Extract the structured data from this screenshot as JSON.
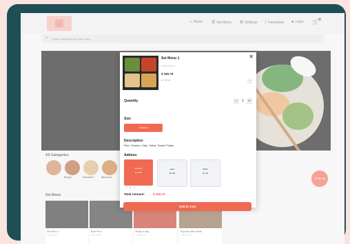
{
  "header": {
    "nav": [
      {
        "label": "Home",
        "icon": "home-icon"
      },
      {
        "label": "Set Menu",
        "icon": "menu-icon"
      },
      {
        "label": "Settings",
        "icon": "gear-icon"
      },
      {
        "label": "Favourites",
        "icon": "heart-icon"
      },
      {
        "label": "Login",
        "icon": "user-icon"
      }
    ]
  },
  "search": {
    "placeholder": "Search anything and find order..."
  },
  "categories": {
    "title": "All Categories",
    "items": [
      {
        "label": ""
      },
      {
        "label": "Burger"
      },
      {
        "label": "Sandwich"
      },
      {
        "label": "Barbecue"
      }
    ]
  },
  "fab": {
    "label": "Order All"
  },
  "set_menu": {
    "title": "Set Menu",
    "cards": [
      {
        "name": "Set Menu 1",
        "stars": "★★★★★"
      },
      {
        "name": "Bunt Set 2",
        "stars": "★★★★★"
      },
      {
        "name": "Single & Hay",
        "stars": "★★★★★"
      },
      {
        "name": "Popcorn With Steak",
        "stars": "★★★★★"
      }
    ]
  },
  "modal": {
    "title": "Set Menu 1",
    "stars": "★★★★★",
    "price": "$ 150.70",
    "old_price": "$ 230.00",
    "quantity_label": "Quantity",
    "quantity_value": "1",
    "minus": "−",
    "plus": "+",
    "size_label": "Size",
    "size_option": "Normal",
    "description_label": "Description",
    "description_text": "Rice, Chicken, Cake, Salad, Smash Potato",
    "addons_label": "Addons",
    "addons": [
      {
        "name": "Chicken",
        "price": "$ 20.00",
        "selected": true
      },
      {
        "name": "Cake",
        "price": "$ 5.00",
        "selected": false
      },
      {
        "name": "Water",
        "price": "$ 2.00",
        "selected": false
      }
    ],
    "addon_stepper": {
      "minus": "−",
      "value": "1",
      "plus": "+"
    },
    "total_label": "Total Amount:",
    "total_value": "$ 150.70",
    "add_to_cart": "Add to Cart"
  },
  "colors": {
    "accent": "#f06a53",
    "frame": "#1f4e57",
    "background": "#fbe3df"
  }
}
